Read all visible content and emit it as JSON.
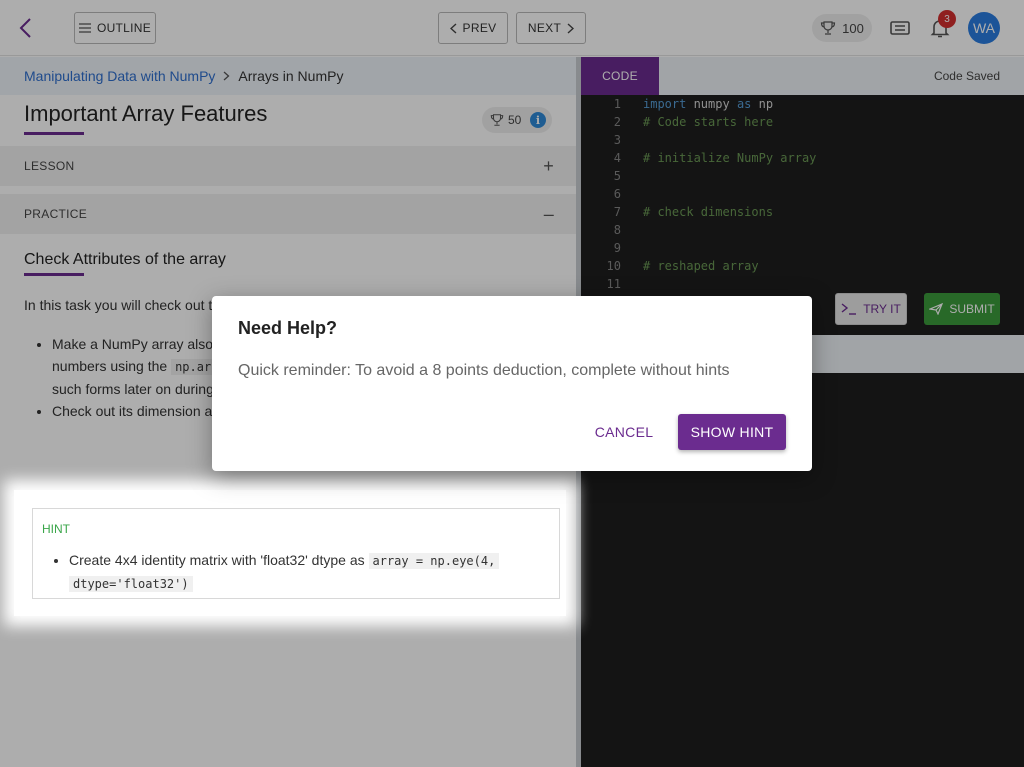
{
  "topbar": {
    "outline_label": "OUTLINE",
    "prev_label": "PREV",
    "next_label": "NEXT",
    "score": "100",
    "notifications": "3",
    "avatar_initials": "WA",
    "icons": [
      "back-arrow-icon",
      "menu-icon",
      "chevron-left-icon",
      "chevron-right-icon",
      "trophy-icon",
      "ticket-icon",
      "bell-icon"
    ]
  },
  "breadcrumb": {
    "course": "Manipulating Data with NumPy",
    "current": "Arrays in NumPy"
  },
  "lesson": {
    "title": "Important Array Features",
    "points": "50",
    "lesson_section": "LESSON",
    "practice_section": "PRACTICE",
    "task_title": "Check Attributes of the array",
    "task_intro": "In this task you will check out t",
    "bullet1_a": "Make a NumPy array also",
    "bullet1_b": "numbers using the",
    "bullet1_code": "np.ar",
    "bullet1_c": "such forms later on during",
    "bullet2": "Check out its dimension a"
  },
  "hint": {
    "label": "HINT",
    "text": "Create 4x4 identity matrix with 'float32' dtype as",
    "code1": "array = np.eye(4,",
    "code2": "dtype='float32')"
  },
  "editor": {
    "tab_label": "CODE",
    "status": "Code Saved",
    "lines": [
      {
        "n": "1",
        "kw1": "import",
        "t": " numpy ",
        "kw2": "as",
        "t2": " np",
        "c": ""
      },
      {
        "n": "2",
        "c": "# Code starts here"
      },
      {
        "n": "3",
        "c": ""
      },
      {
        "n": "4",
        "c": "# initialize NumPy array"
      },
      {
        "n": "5",
        "c": ""
      },
      {
        "n": "6",
        "c": ""
      },
      {
        "n": "7",
        "c": "# check dimensions"
      },
      {
        "n": "8",
        "c": ""
      },
      {
        "n": "9",
        "c": ""
      },
      {
        "n": "10",
        "c": "# reshaped array"
      },
      {
        "n": "11",
        "c": ""
      }
    ],
    "try_label": "TRY IT",
    "submit_label": "SUBMIT"
  },
  "dialog": {
    "title": "Need Help?",
    "message": "Quick reminder: To avoid a 8 points deduction, complete without hints",
    "cancel_label": "CANCEL",
    "confirm_label": "SHOW HINT"
  },
  "colors": {
    "brand_purple": "#6b2c8f",
    "link_blue": "#2e6fcf",
    "submit_green": "#3c9b3c",
    "hint_green": "#3aa64a",
    "notif_red": "#d32f2f"
  }
}
